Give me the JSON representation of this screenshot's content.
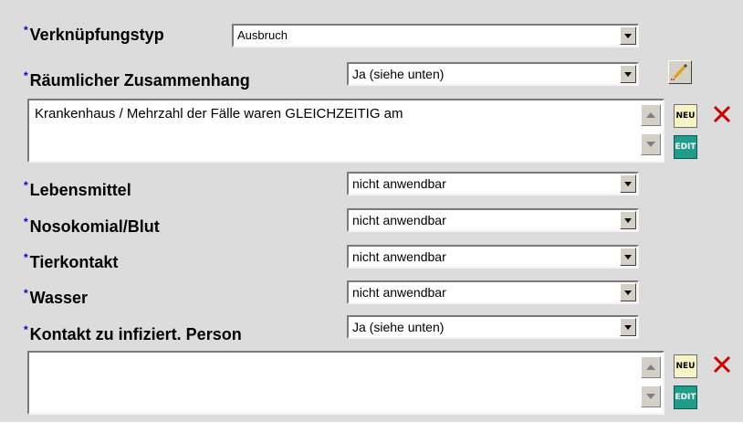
{
  "required_marker": "*",
  "fields": {
    "verknuepfungstyp": {
      "label": "Verknüpfungstyp",
      "value": "Ausbruch"
    },
    "raeumlich": {
      "label": "Räumlicher Zusammenhang",
      "value": "Ja (siehe unten)"
    },
    "raeumlich_memo": {
      "text": "Krankenhaus / Mehrzahl der Fälle waren GLEICHZEITIG am"
    },
    "lebensmittel": {
      "label": "Lebensmittel",
      "value": "nicht anwendbar"
    },
    "nosokomial": {
      "label": "Nosokomial/Blut",
      "value": "nicht anwendbar"
    },
    "tierkontakt": {
      "label": "Tierkontakt",
      "value": "nicht anwendbar"
    },
    "wasser": {
      "label": "Wasser",
      "value": "nicht anwendbar"
    },
    "kontakt": {
      "label": "Kontakt zu infiziert. Person",
      "value": "Ja (siehe unten)"
    },
    "kontakt_memo": {
      "text": ""
    }
  },
  "buttons": {
    "neu_label": "NEU",
    "edit_label": "EDIT"
  },
  "icons": {
    "dropdown": "chevron-down-icon",
    "scroll_up": "scroll-up-icon",
    "scroll_down": "scroll-down-icon",
    "pencil": "pencil-icon",
    "delete": "delete-x-icon"
  },
  "colors": {
    "required_marker": "#0000cc",
    "panel_bg": "#dcdcdc",
    "neu_bg": "#f6f3c4",
    "edit_bg": "#1f9c8a",
    "delete_x": "#cc0000"
  }
}
